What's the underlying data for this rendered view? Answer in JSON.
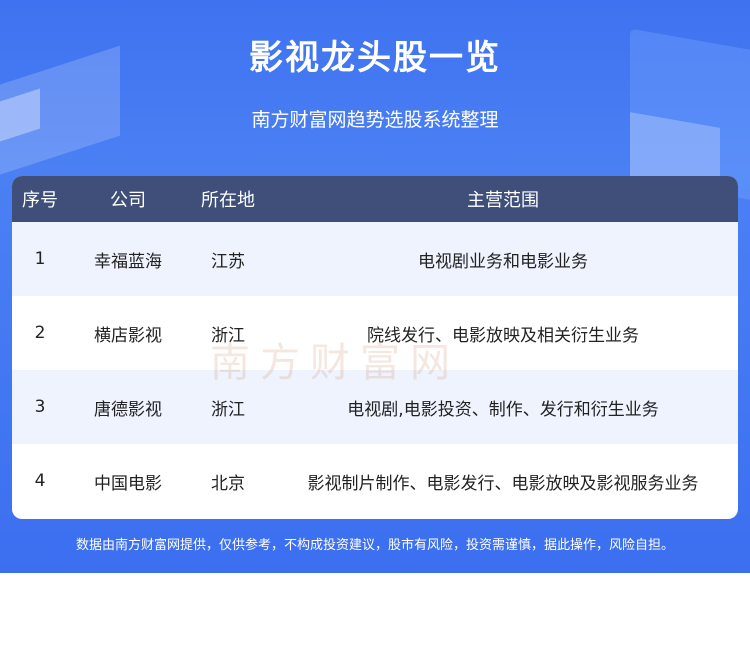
{
  "header": {
    "title": "影视龙头股一览",
    "subtitle": "南方财富网趋势选股系统整理"
  },
  "table": {
    "columns": [
      "序号",
      "公司",
      "所在地",
      "主营范围"
    ],
    "rows": [
      {
        "index": "1",
        "company": "幸福蓝海",
        "location": "江苏",
        "business": "电视剧业务和电影业务"
      },
      {
        "index": "2",
        "company": "横店影视",
        "location": "浙江",
        "business": "院线发行、电影放映及相关衍生业务"
      },
      {
        "index": "3",
        "company": "唐德影视",
        "location": "浙江",
        "business": "电视剧,电影投资、制作、发行和衍生业务"
      },
      {
        "index": "4",
        "company": "中国电影",
        "location": "北京",
        "business": "影视制片制作、电影发行、电影放映及影视服务业务"
      }
    ]
  },
  "watermark": "南方财富网",
  "footer": {
    "disclaimer": "数据由南方财富网提供，仅供参考，不构成投资建议，股市有风险，投资需谨慎，据此操作，风险自担。"
  },
  "colors": {
    "banner": "#3f72f0",
    "header_row": "#3f4f7a",
    "alt_row": "#eef3fd"
  }
}
